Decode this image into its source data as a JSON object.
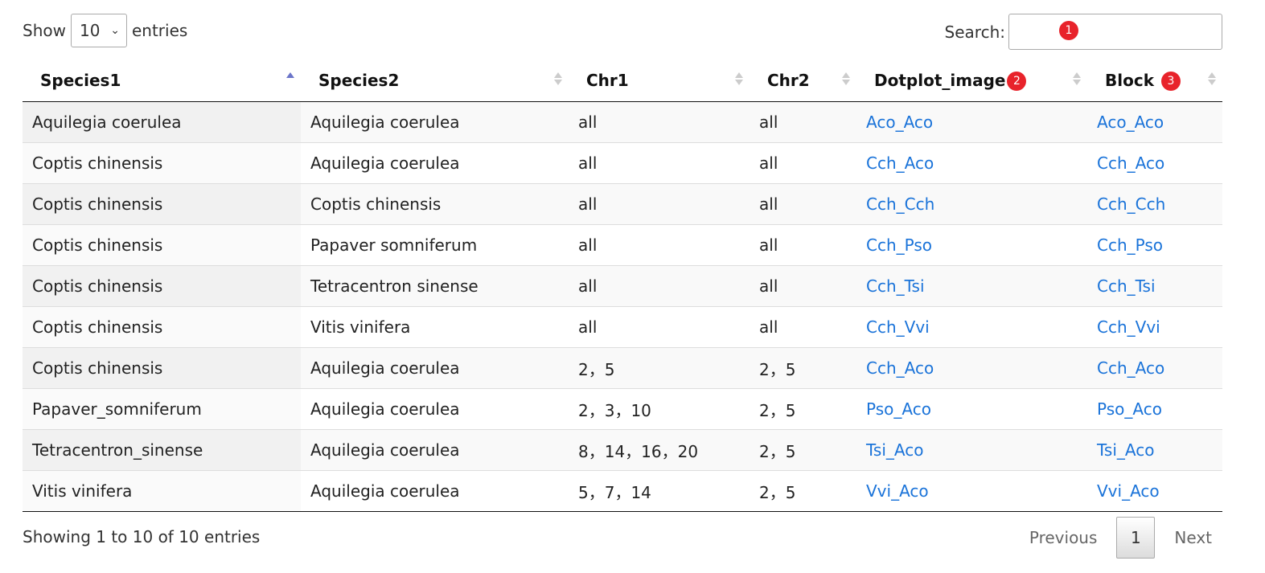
{
  "controls": {
    "show_label": "Show",
    "page_length_value": "10",
    "entries_label": "entries",
    "search_label": "Search:",
    "search_value": "",
    "search_badge": "1"
  },
  "table": {
    "columns": [
      {
        "label": "Species1",
        "sort_state": "ascending"
      },
      {
        "label": "Species2",
        "sort_state": "none"
      },
      {
        "label": "Chr1",
        "sort_state": "none"
      },
      {
        "label": "Chr2",
        "sort_state": "none"
      },
      {
        "label": "Dotplot_image",
        "sort_state": "none",
        "badge": "2"
      },
      {
        "label": "Block",
        "sort_state": "none",
        "badge": "3"
      }
    ],
    "rows": [
      {
        "species1": "Aquilegia coerulea",
        "species2": "Aquilegia coerulea",
        "chr1": "all",
        "chr2": "all",
        "dotplot": "Aco_Aco",
        "block": "Aco_Aco"
      },
      {
        "species1": "Coptis chinensis",
        "species2": "Aquilegia coerulea",
        "chr1": "all",
        "chr2": "all",
        "dotplot": "Cch_Aco",
        "block": "Cch_Aco"
      },
      {
        "species1": "Coptis chinensis",
        "species2": "Coptis chinensis",
        "chr1": "all",
        "chr2": "all",
        "dotplot": "Cch_Cch",
        "block": "Cch_Cch"
      },
      {
        "species1": "Coptis chinensis",
        "species2": "Papaver somniferum",
        "chr1": "all",
        "chr2": "all",
        "dotplot": "Cch_Pso",
        "block": "Cch_Pso"
      },
      {
        "species1": "Coptis chinensis",
        "species2": "Tetracentron sinense",
        "chr1": "all",
        "chr2": "all",
        "dotplot": "Cch_Tsi",
        "block": "Cch_Tsi"
      },
      {
        "species1": "Coptis chinensis",
        "species2": "Vitis vinifera",
        "chr1": "all",
        "chr2": "all",
        "dotplot": "Cch_Vvi",
        "block": "Cch_Vvi"
      },
      {
        "species1": "Coptis chinensis",
        "species2": "Aquilegia coerulea",
        "chr1": "2，5",
        "chr2": "2，5",
        "dotplot": "Cch_Aco",
        "block": "Cch_Aco"
      },
      {
        "species1": "Papaver_somniferum",
        "species2": "Aquilegia coerulea",
        "chr1": "2，3，10",
        "chr2": "2，5",
        "dotplot": "Pso_Aco",
        "block": "Pso_Aco"
      },
      {
        "species1": "Tetracentron_sinense",
        "species2": "Aquilegia coerulea",
        "chr1": "8，14，16，20",
        "chr2": "2，5",
        "dotplot": "Tsi_Aco",
        "block": "Tsi_Aco"
      },
      {
        "species1": "Vitis vinifera",
        "species2": "Aquilegia coerulea",
        "chr1": "5，7，14",
        "chr2": "2，5",
        "dotplot": "Vvi_Aco",
        "block": "Vvi_Aco"
      }
    ]
  },
  "footer": {
    "info": "Showing 1 to 10 of 10 entries",
    "previous_label": "Previous",
    "current_page": "1",
    "next_label": "Next"
  },
  "colors": {
    "link": "#1a73d9",
    "badge": "#e8232b",
    "sort_active": "#6b75c9"
  }
}
